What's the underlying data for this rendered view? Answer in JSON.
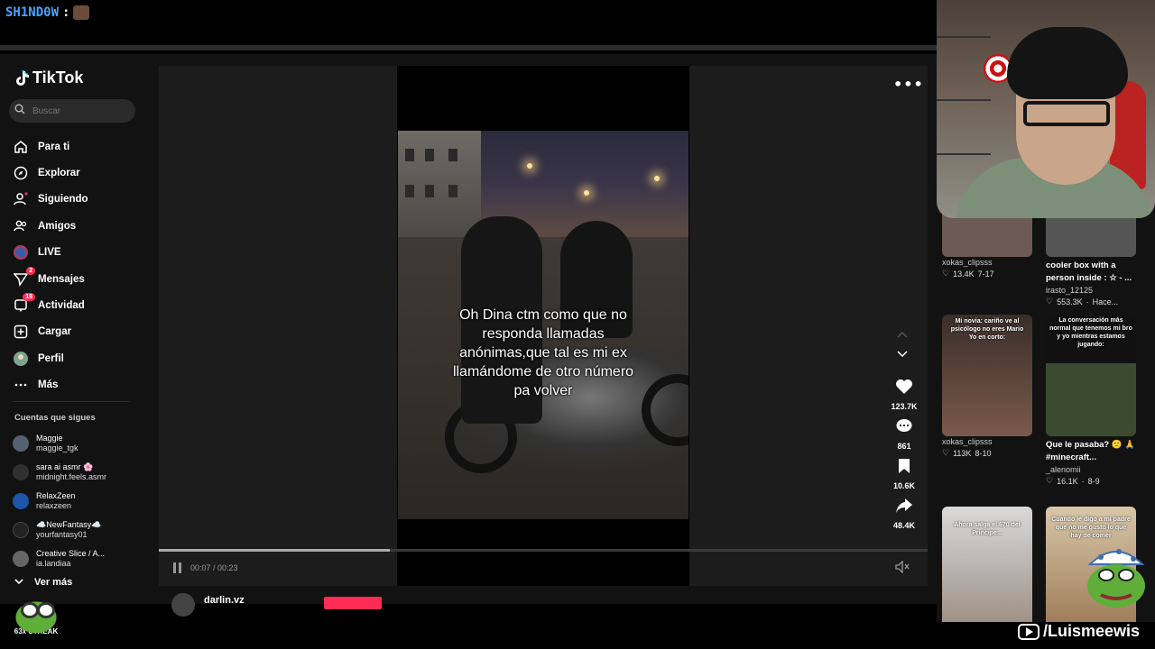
{
  "stream": {
    "chat_user": "SH1ND0W",
    "chat_separator": ":",
    "streak_label": "63x STREAK",
    "channel_name": "/Luismeewis"
  },
  "tiktok": {
    "logo_text": "TikTok",
    "search_placeholder": "Buscar",
    "nav": [
      {
        "label": "Para ti",
        "icon": "home-icon"
      },
      {
        "label": "Explorar",
        "icon": "compass-icon"
      },
      {
        "label": "Siguiendo",
        "icon": "following-icon",
        "dot": true
      },
      {
        "label": "Amigos",
        "icon": "friends-icon"
      },
      {
        "label": "LIVE",
        "icon": "live-icon"
      },
      {
        "label": "Mensajes",
        "icon": "messages-icon",
        "badge": "2"
      },
      {
        "label": "Actividad",
        "icon": "activity-icon",
        "badge": "18"
      },
      {
        "label": "Cargar",
        "icon": "upload-icon"
      },
      {
        "label": "Perfil",
        "icon": "profile-icon"
      },
      {
        "label": "Más",
        "icon": "more-icon"
      }
    ],
    "following_title": "Cuentas que sigues",
    "following": [
      {
        "name": "Maggie",
        "handle": "maggie_tgk",
        "color": "#556070"
      },
      {
        "name": "sara ai asmr 🌸",
        "handle": "midnight.feels.asmr",
        "color": "#303030"
      },
      {
        "name": "RelaxZeen",
        "handle": "relaxzeen",
        "color": "#1d55a8"
      },
      {
        "name": "☁️NewFantasy☁️",
        "handle": "yourfantasy01",
        "color": "#222"
      },
      {
        "name": "Creative Slice / A...",
        "handle": "ia.landiaa",
        "color": "#666"
      }
    ],
    "see_more": "Ver más",
    "video": {
      "caption": "Oh Dina ctm como que no responda llamadas anónimas,que tal es mi ex llamándome de otro número pa volver",
      "likes": "123.7K",
      "comments": "861",
      "saves": "10.6K",
      "shares": "48.4K",
      "time": "00:07 / 00:23",
      "progress": 0.3
    },
    "next_user": "darlin.vz"
  },
  "grid": [
    {
      "title": "",
      "user": "xokas_clipsss",
      "likes": "13.4K",
      "date": "7-17",
      "thumb_text": "",
      "thumb_color": "#6b5a55"
    },
    {
      "title": "cooler box with a person inside : ☆ - ...",
      "user": "irasto_12125",
      "likes": "553.3K",
      "date": "Hace...",
      "thumb_text": "",
      "thumb_color": "#555"
    },
    {
      "title": "",
      "user": "xokas_clipsss",
      "likes": "113K",
      "date": "8-10",
      "thumb_text": "Mi novia: cariño ve al psicólogo no eres Mario\nYo en corto:",
      "thumb_color": "#7a5a4a"
    },
    {
      "title": "Que le pasaba? 🙁 🙏 #minecraft...",
      "user": "_alenomii",
      "likes": "16.1K",
      "date": "8-9",
      "thumb_text": "La conversación más normal que tenemos mi bro y yo mientras estamos jugando:",
      "thumb_color": "#3c4a30"
    },
    {
      "title": "",
      "user": "",
      "likes": "",
      "date": "",
      "thumb_text": "Ahora salga el 670 del Principe...",
      "thumb_color": "#cfcfcf"
    },
    {
      "title": "",
      "user": "",
      "likes": "",
      "date": "",
      "thumb_text": "Cuando le digo a mi padre que no me gusto lo que hay de comer",
      "thumb_color": "#bba27d"
    }
  ]
}
